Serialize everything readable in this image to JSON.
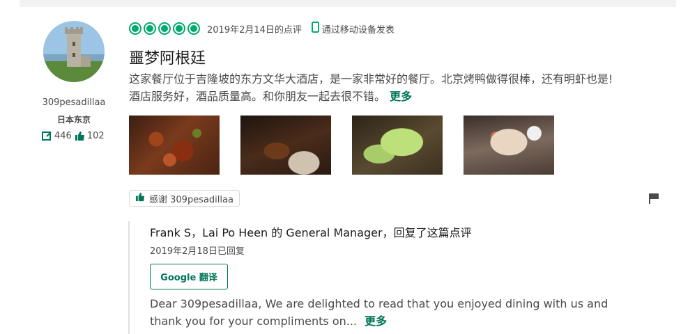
{
  "reviewer": {
    "username": "309pesadillaa",
    "location": "日本东京",
    "review_count": "446",
    "helpful_count": "102"
  },
  "review": {
    "rating": 5,
    "date": "2019年2月14日的点评",
    "mobile_label": "通过移动设备发表",
    "title": "噩梦阿根廷",
    "text": "这家餐厅位于吉隆坡的东方文华大酒店，是一家非常好的餐厅。北京烤鸭做得很棒，还有明虾也是!酒店服务好，酒品质量高。和你朋友一起去很不错。",
    "more_label": "更多"
  },
  "actions": {
    "thank_label": "感谢 309pesadillaa"
  },
  "reply": {
    "header": "Frank S，Lai Po Heen 的 General Manager，回复了这篇点评",
    "date": "2019年2月18日已回复",
    "translate_label": "Google 翻译",
    "text": "Dear 309pesadillaa, We are delighted to read that you enjoyed dining with us and thank you for your compliments on...",
    "more_label": "更多"
  },
  "colors": {
    "brand_green": "#00aa6c",
    "link_green": "#00765a"
  },
  "icons": [
    "bubble-rating-icon",
    "mobile-icon",
    "review-edit-icon",
    "thumbs-up-icon",
    "flag-icon"
  ]
}
